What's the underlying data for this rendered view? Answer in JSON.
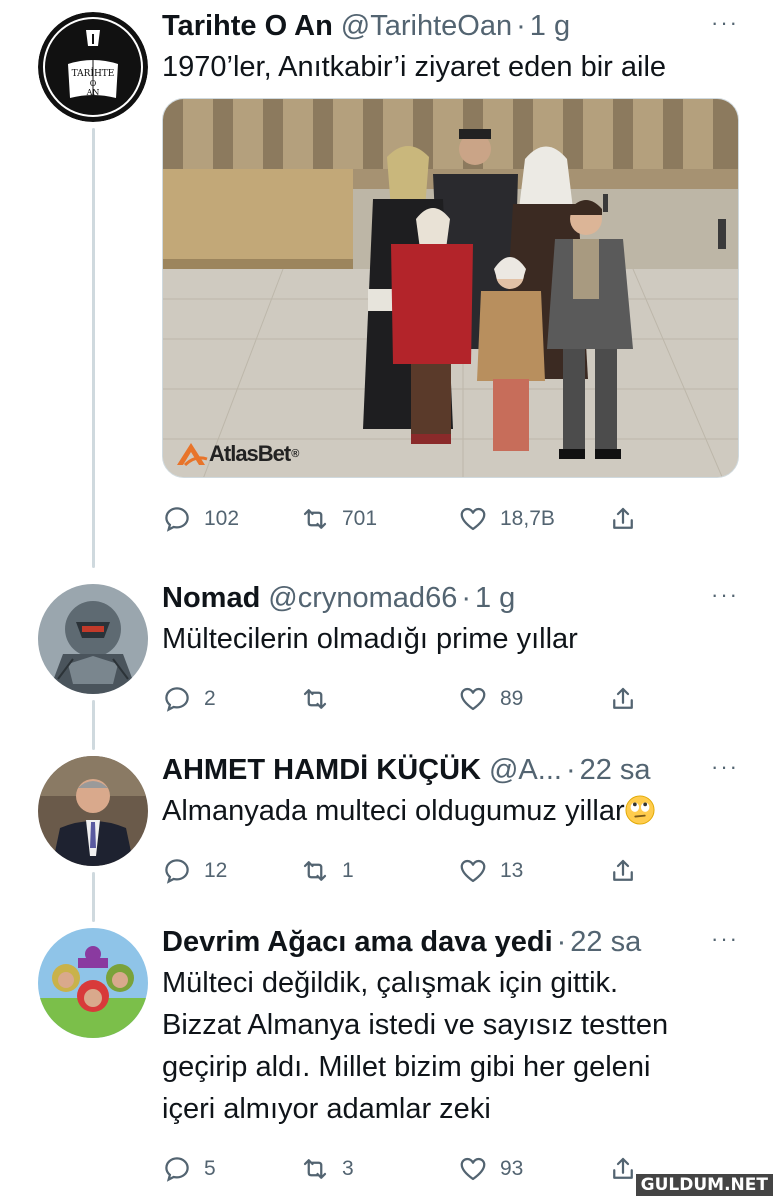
{
  "tweets": [
    {
      "name": "Tarihte O An",
      "handle": "@TarihteOan",
      "dot": "·",
      "time": "1 g",
      "text": "1970’ler, Anıtkabir’i ziyaret eden bir aile",
      "avatar_text": [
        "TARİHTE",
        "O",
        "AN"
      ],
      "media_watermark": "AtlasBet",
      "media_watermark_reg": "®",
      "replies": "102",
      "retweets": "701",
      "likes": "18,7B"
    },
    {
      "name": "Nomad",
      "handle": "@crynomad66",
      "dot": "·",
      "time": "1 g",
      "text": "Mültecilerin olmadığı prime yıllar",
      "replies": "2",
      "retweets": "",
      "likes": "89"
    },
    {
      "name": "AHMET HAMDİ KÜÇÜK",
      "handle": "@A...",
      "dot": "·",
      "time": "22 sa",
      "text": "Almanyada multeci oldugumuz yillar",
      "emoji": "eye-roll-emoji",
      "replies": "12",
      "retweets": "1",
      "likes": "13"
    },
    {
      "name": "Devrim Ağacı ama dava yedi",
      "handle": "",
      "dot": "·",
      "time": "22 sa",
      "text_lines": [
        "Mülteci değildik, çalışmak için gittik.",
        "Bizzat Almanya istedi ve sayısız testten",
        "geçirip aldı. Millet bizim gibi her geleni",
        "içeri almıyor adamlar zeki"
      ],
      "replies": "5",
      "retweets": "3",
      "likes": "93"
    }
  ],
  "more_label": "···",
  "site_watermark": "GULDUM.NET",
  "colors": {
    "text": "#0f1419",
    "secondary": "#536471",
    "line": "#cfd9de"
  },
  "icons": [
    "reply-icon",
    "retweet-icon",
    "like-icon",
    "share-icon",
    "more-icon"
  ]
}
